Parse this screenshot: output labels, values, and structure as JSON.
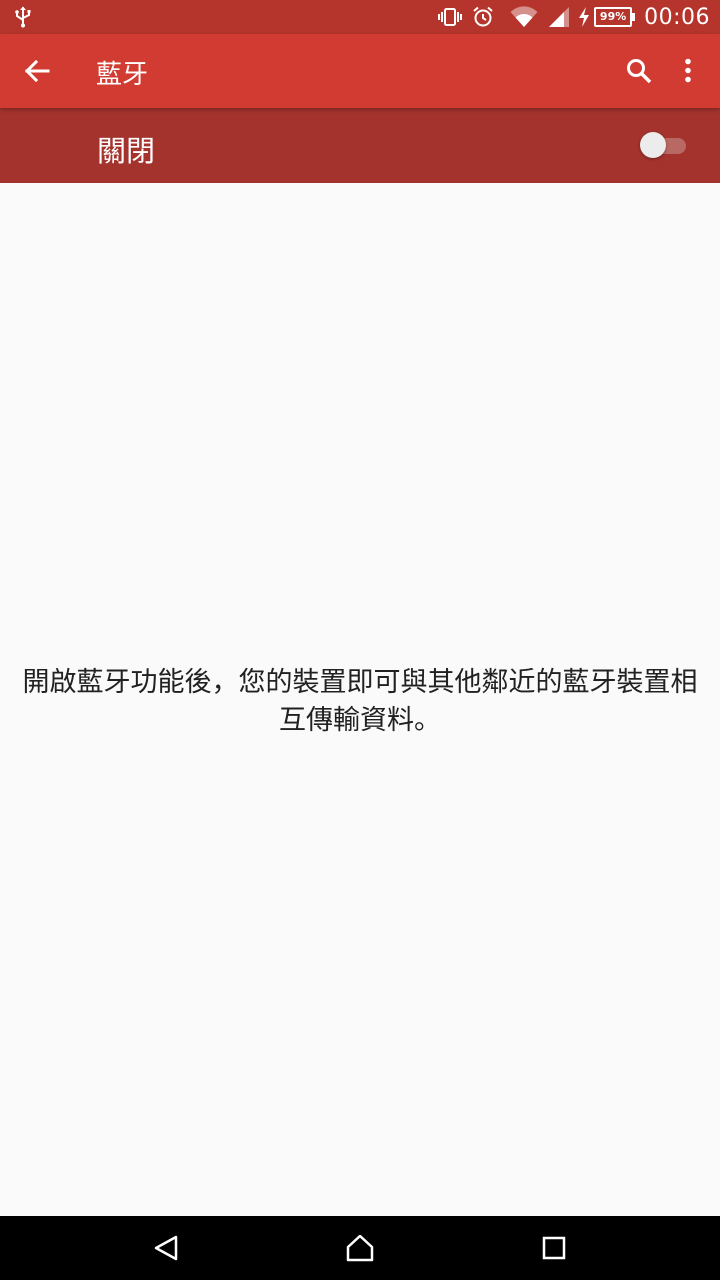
{
  "status_bar": {
    "icons": [
      "usb-icon",
      "vibrate-icon",
      "alarm-icon",
      "wifi-icon",
      "signal-icon",
      "charging-icon"
    ],
    "battery": "99%",
    "time": "00:06",
    "color": "#b5352c"
  },
  "toolbar": {
    "title": "藍牙",
    "color": "#d13b31",
    "icons": [
      "back-arrow-icon",
      "search-icon",
      "more-vert-icon"
    ]
  },
  "switch_bar": {
    "label": "關閉",
    "state": "off",
    "color": "#a4332d"
  },
  "main": {
    "message": "開啟藍牙功能後，您的裝置即可與其他鄰近的藍牙裝置相互傳輸資料。"
  },
  "nav_bar": {
    "icons": [
      "back-triangle-icon",
      "home-icon",
      "recents-square-icon"
    ]
  }
}
